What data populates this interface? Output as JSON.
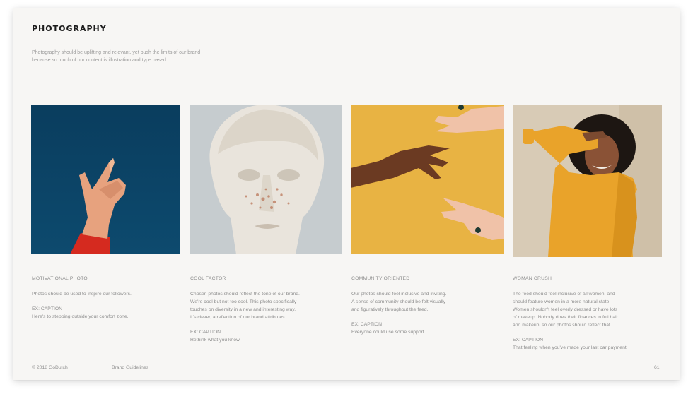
{
  "page": {
    "title": "PHOTOGRAPHY",
    "intro": "Photography should be uplifting and relevant, yet push the limits of our brand because so much of our content is illustration and type based."
  },
  "columns": [
    {
      "label": "MOTIVATIONAL PHOTO",
      "body": "Photos should be used to inspire our followers.",
      "caption_title": "EX: CAPTION",
      "caption": "Here's to stepping outside your comfort zone."
    },
    {
      "label": "COOL FACTOR",
      "body": "Chosen photos should reflect the tone of our brand.\nWe're cool but not too cool. This photo specifically\ntouches on diversity in a new and interesting way.\nIt's clever, a reflection of our brand attributes.",
      "caption_title": "EX: CAPTION",
      "caption": "Rethink what you know."
    },
    {
      "label": "COMMUNITY ORIENTED",
      "body": "Our photos should feel inclusive and inviting.\nA sense of community should be felt visually\nand figuratively throughout the feed.",
      "caption_title": "EX: CAPTION",
      "caption": "Everyone could use some support."
    },
    {
      "label": "WOMAN CRUSH",
      "body": "The feed should feel inclusive of all women, and\nshould feature women in a more natural state.\nWomen shouldn't feel overly dressed or have lots\nof makeup. Nobody does their finances in full hair\nand makeup, so our photos should reflect that.",
      "caption_title": "EX: CAPTION",
      "caption": "That feeling when you've made your last car payment."
    }
  ],
  "footer": {
    "copyright": "© 2018 GoDutch",
    "section": "Brand Guidelines",
    "page_number": "61"
  },
  "colors": {
    "photo1_bg": "#0b4467",
    "photo2_bg": "#c5cbcd",
    "photo3_bg": "#e8b343",
    "photo4_bg": "#d9cbb5",
    "sweater": "#e9a32a",
    "sleeve_red": "#d52a1f"
  }
}
